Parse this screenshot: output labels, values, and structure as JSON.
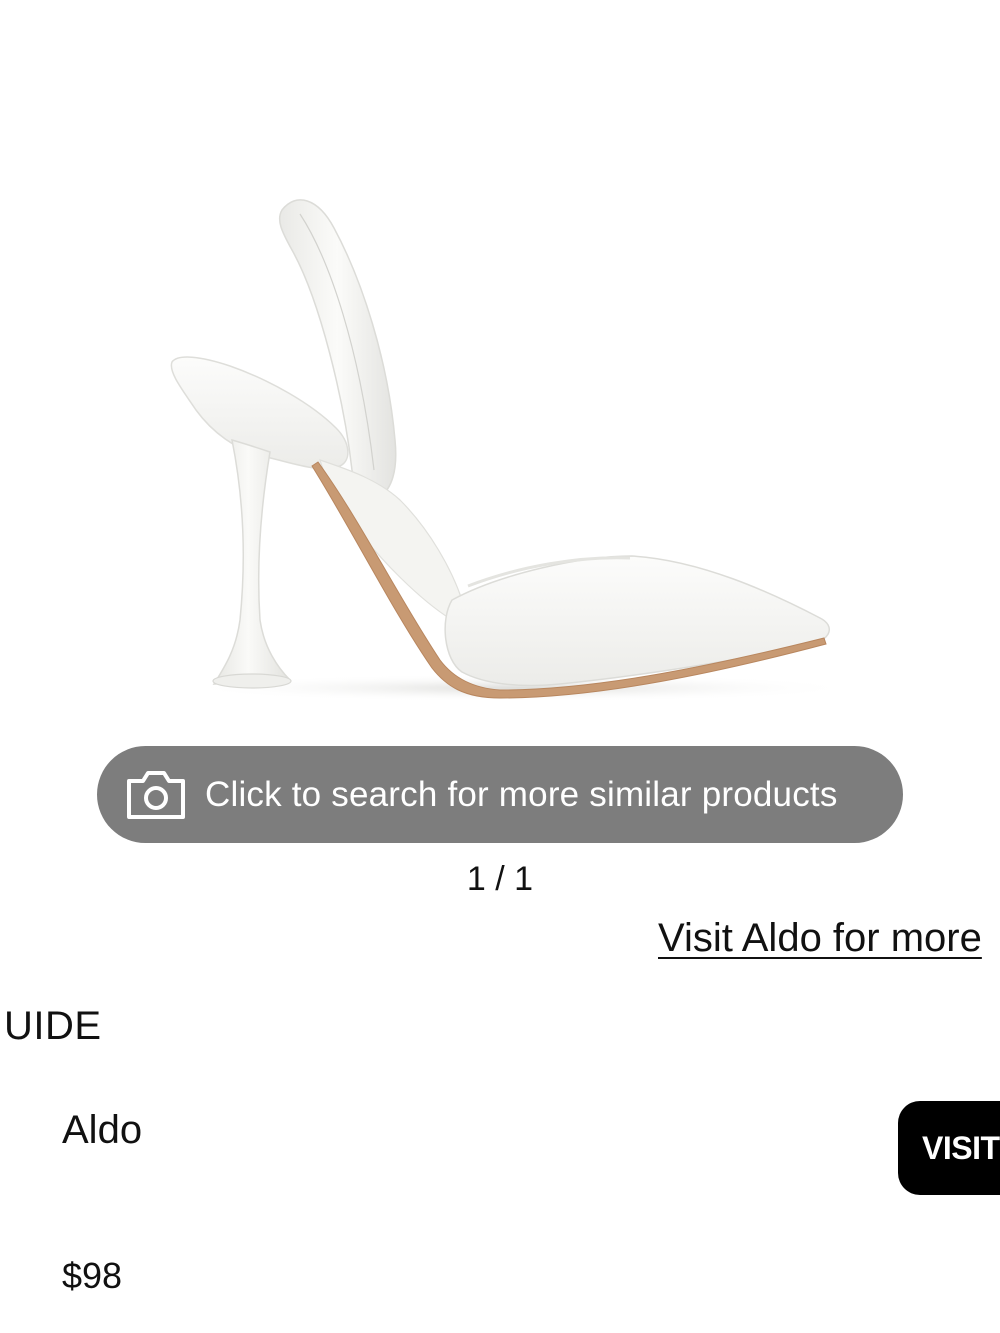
{
  "product_image": {
    "icon": "white-slingback-pump-image"
  },
  "visual_search": {
    "icon": "camera-icon",
    "label": "Click to search for more similar products"
  },
  "gallery": {
    "counter": "1 / 1"
  },
  "retailer_link": {
    "label": "Visit Aldo for more"
  },
  "size_guide": {
    "label": "UIDE"
  },
  "offer": {
    "brand": "Aldo",
    "price": "$98",
    "visit_label": "VISIT"
  },
  "colors": {
    "pill_background": "#7d7d7d",
    "button_background": "#000000",
    "text": "#111111"
  }
}
